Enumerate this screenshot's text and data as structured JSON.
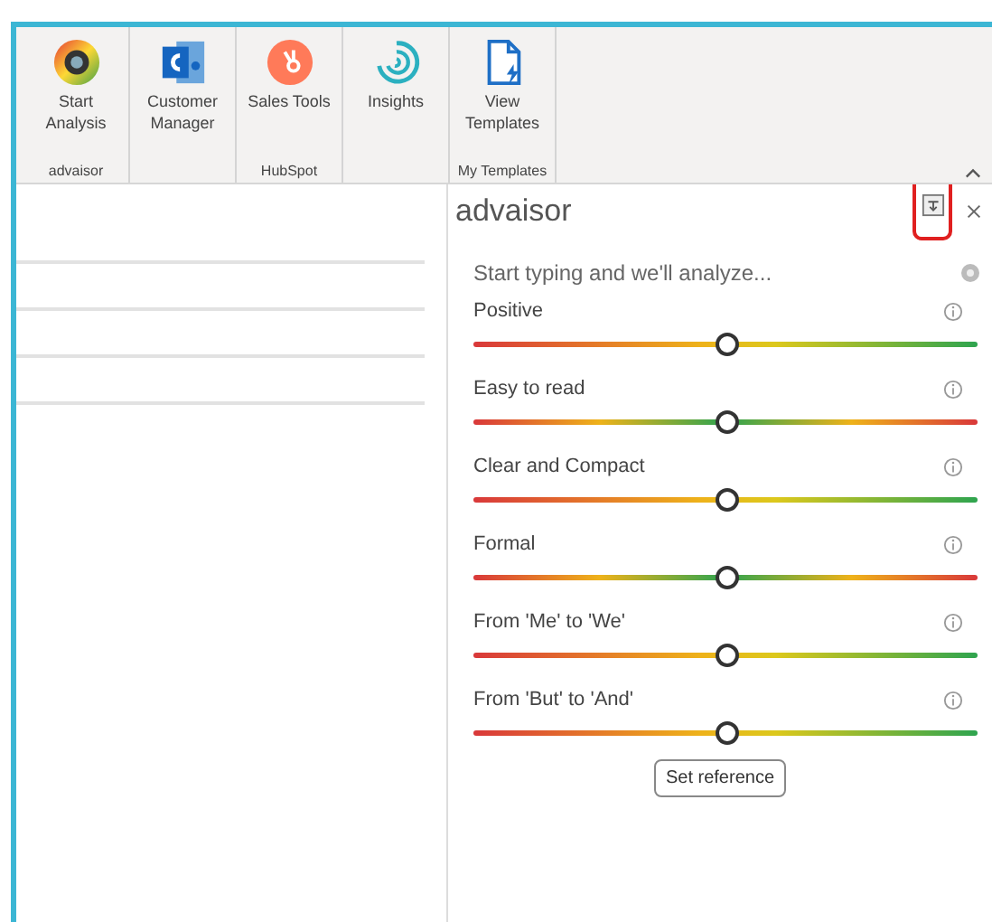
{
  "ribbon": {
    "groups": [
      {
        "label": "advaisor",
        "buttons": [
          {
            "kind": "analysis",
            "label": "Start Analysis"
          }
        ]
      },
      {
        "buttons": [
          {
            "kind": "contacts",
            "label": "Customer Manager"
          }
        ]
      },
      {
        "label": "HubSpot",
        "buttons": [
          {
            "kind": "hubspot",
            "label": "Sales Tools"
          }
        ]
      },
      {
        "buttons": [
          {
            "kind": "insights",
            "label": "Insights"
          }
        ]
      },
      {
        "label": "My Templates",
        "buttons": [
          {
            "kind": "templates",
            "label": "View Templates"
          }
        ]
      }
    ]
  },
  "pane": {
    "title": "advaisor",
    "input": {
      "placeholder": "Start typing and we'll analyze..."
    },
    "sliders": [
      {
        "label": "Positive",
        "kind": "ascending",
        "level": 0.5
      },
      {
        "label": "Easy to read",
        "kind": "peak",
        "level": 0.5
      },
      {
        "label": "Clear and Compact",
        "kind": "ascending",
        "level": 0.5
      },
      {
        "label": "Formal",
        "kind": "peak",
        "level": 0.5
      },
      {
        "label": "From 'Me' to 'We'",
        "kind": "ascending",
        "level": 0.5
      },
      {
        "label": "From 'But' to 'And'",
        "kind": "ascending",
        "level": 0.5
      }
    ],
    "button": "Set reference"
  }
}
